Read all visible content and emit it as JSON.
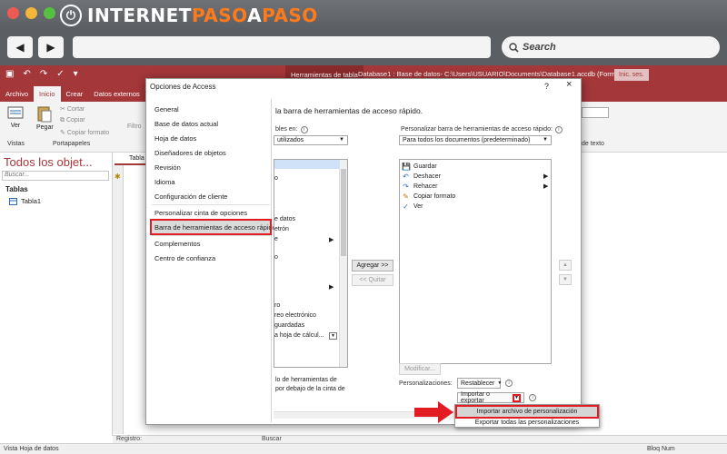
{
  "colors": {
    "access_red": "#a4373a",
    "highlight_red": "#e31b23",
    "brand_orange": "#ff7a1a"
  },
  "browser": {
    "traffic_lights": [
      "#ee5a52",
      "#f5b43a",
      "#56c041"
    ],
    "logo": {
      "part1": "INTERNET",
      "part2": "PASO",
      "part3": "A",
      "part4": "PASO"
    },
    "back_icon": "◀",
    "forward_icon": "▶",
    "search_label": "Search"
  },
  "access": {
    "context_tab": "Herramientas de tabla",
    "doc_title": "Database1 : Base de datos- C:\\Users\\USUARIO\\Documents\\Database1.accdb (Formato...",
    "signin": "Inic. ses.",
    "tabs": [
      "Archivo",
      "Inicio",
      "Crear",
      "Datos externos"
    ],
    "ribbon": {
      "ver": "Ver",
      "pegar": "Pegar",
      "cortar": "Cortar",
      "copiar": "Copiar",
      "copiar_formato": "Copiar formato",
      "filtro": "Filtro",
      "vistas": "Vistas",
      "portapapeles": "Portapapeles",
      "formato_texto": "de texto"
    },
    "nav": {
      "heading": "Todos los objet...",
      "search": "Buscar...",
      "section": "Tablas",
      "item": "Tabla1"
    },
    "doc_tab": "Tabla",
    "record_bar": "Registro:",
    "record_search": "Buscar",
    "status_left": "Vista Hoja de datos",
    "status_right": "Bloq Num"
  },
  "dialog": {
    "title": "Opciones de Access",
    "help": "?",
    "close": "×",
    "categories": [
      "General",
      "Base de datos actual",
      "Hoja de datos",
      "Diseñadores de objetos",
      "Revisión",
      "Idioma",
      "Configuración de cliente",
      "Personalizar cinta de opciones",
      "Barra de herramientas de acceso rápido",
      "Complementos",
      "Centro de confianza"
    ],
    "heading": "la barra de herramientas de acceso rápido.",
    "left_label": "bles en:",
    "left_dropdown": "utilizados",
    "left_fragments": [
      "o",
      "e datos",
      "etrón",
      "e",
      "o",
      "ro",
      "reo electrónico",
      "guardadas",
      "a hoja de cálcul...",
      "lo de herramientas de",
      "por debajo de la cinta de"
    ],
    "right_label": "Personalizar barra de herramientas de acceso rápido:",
    "right_dropdown": "Para todos los documentos (predeterminado)",
    "qat_items": [
      {
        "icon": "save-icon",
        "glyph": "💾",
        "label": "Guardar"
      },
      {
        "icon": "undo-icon",
        "glyph": "↶",
        "label": "Deshacer"
      },
      {
        "icon": "redo-icon",
        "glyph": "↷",
        "label": "Rehacer"
      },
      {
        "icon": "format-painter-icon",
        "glyph": "✎",
        "label": "Copiar formato"
      },
      {
        "icon": "view-icon",
        "glyph": "✓",
        "label": "Ver"
      }
    ],
    "add_button": "Agregar >>",
    "remove_button": "<< Quitar",
    "modify_button": "Modificar...",
    "personalizations_label": "Personalizaciones:",
    "reset_button": "Restablecer",
    "import_export": "Importar o exportar",
    "popup": [
      "Importar archivo de personalización",
      "Exportar todas las personalizaciones"
    ]
  }
}
